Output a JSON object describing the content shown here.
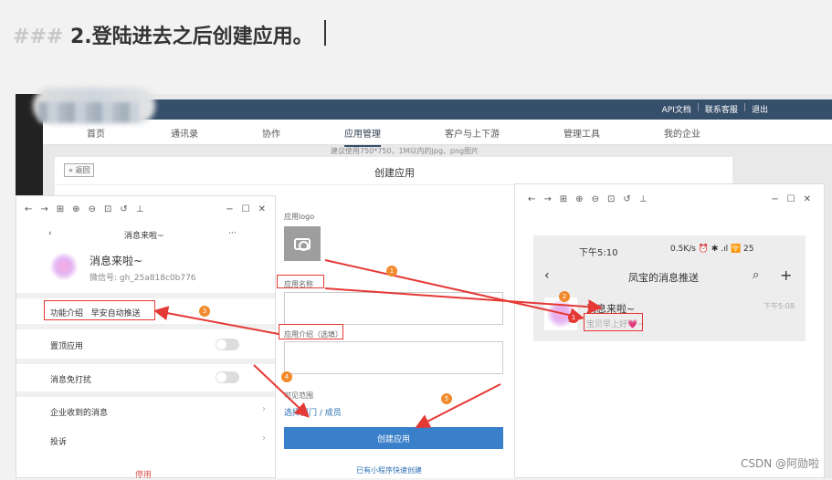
{
  "heading": {
    "hash": "###",
    "text": "2.登陆进去之后创建应用。"
  },
  "portal": {
    "top_links": [
      "API文档",
      "联系客服",
      "退出"
    ],
    "nav": [
      "首页",
      "通讯录",
      "协作",
      "应用管理",
      "客户与上下游",
      "管理工具",
      "我的企业"
    ],
    "back": "« 返回",
    "title": "创建应用",
    "logo_label": "应用logo",
    "logo_hint": "建议使用750*750，1M以内的jpg、png图片",
    "name_label": "应用名称",
    "intro_label": "应用介绍（选填）",
    "scope_label": "可见范围",
    "scope_link": "选择部门 / 成员",
    "create_button": "创建应用",
    "mini_link": "已有小程序快速创建"
  },
  "left_window": {
    "title": "消息来啦~",
    "more": "···",
    "app_name": "消息来啦~",
    "wechat_id": "微信号: gh_25a818c0b776",
    "intro_label": "功能介绍",
    "intro_value": "早安自动推送",
    "pin": "置顶应用",
    "mute": "消息免打扰",
    "enterprise": "企业收到的消息",
    "complain": "投诉",
    "stop": "停用"
  },
  "right_window": {
    "status_time": "下午5:10",
    "status_right": "0.5K/s ⏰ ✱ .ıl 🛜 25",
    "chat_title": "凤宝的消息推送",
    "msg_name": "消息来啦~",
    "msg_text": "宝贝早上好💗~",
    "msg_time": "下午5:08",
    "badge": "1"
  },
  "markers": [
    "1",
    "2",
    "3",
    "4",
    "5"
  ],
  "watermark": "CSDN @阿勋啦"
}
